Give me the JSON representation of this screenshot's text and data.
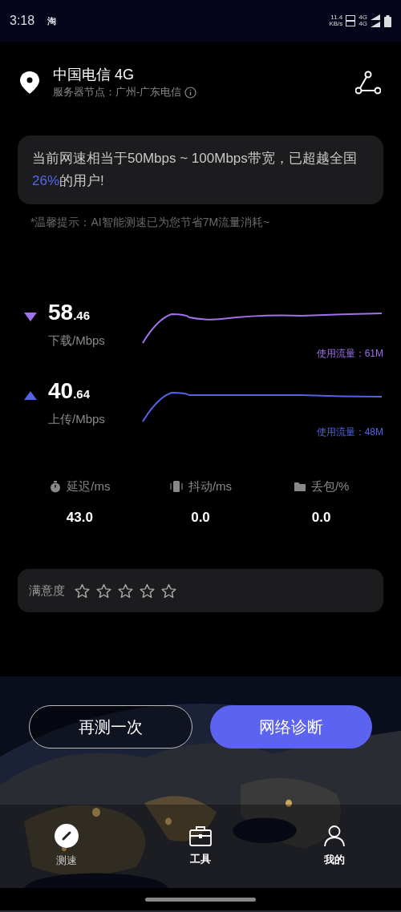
{
  "status_bar": {
    "time": "3:18",
    "app_badge": "淘",
    "net_speed": "11.4",
    "net_unit": "KB/s",
    "sim1": "4G",
    "sim2": "4G"
  },
  "header": {
    "carrier": "中国电信 4G",
    "server": "服务器节点：广州-广东电信"
  },
  "result_card": {
    "text": "当前网速相当于50Mbps ~ 100Mbps带宽，已超越全国**26%**的用户!"
  },
  "tip": "*温馨提示：AI智能测速已为您节省7M流量消耗~",
  "speeds": [
    {
      "kind": "download",
      "value": "58",
      "decimals": ".46",
      "label": "下载/Mbps",
      "usage": "使用流量：61M",
      "color": "#a070ee"
    },
    {
      "kind": "upload",
      "value": "40",
      "decimals": ".64",
      "label": "上传/Mbps",
      "usage": "使用流量：48M",
      "color": "#5562e8"
    }
  ],
  "stats": [
    {
      "kind": "latency",
      "label": "延迟/ms",
      "value": "43.0"
    },
    {
      "kind": "jitter",
      "label": "抖动/ms",
      "value": "0.0"
    },
    {
      "kind": "loss",
      "label": "丢包/%",
      "value": "0.0"
    }
  ],
  "rating": {
    "label": "满意度",
    "stars": 0
  },
  "buttons": [
    {
      "kind": "outline",
      "label": "再测一次"
    },
    {
      "kind": "primary",
      "label": "网络诊断"
    }
  ],
  "tabs": [
    {
      "kind": "speed",
      "label": "测速",
      "selected": true
    },
    {
      "kind": "tools",
      "label": "工具",
      "selected": false
    },
    {
      "kind": "me",
      "label": "我的",
      "selected": false
    }
  ]
}
